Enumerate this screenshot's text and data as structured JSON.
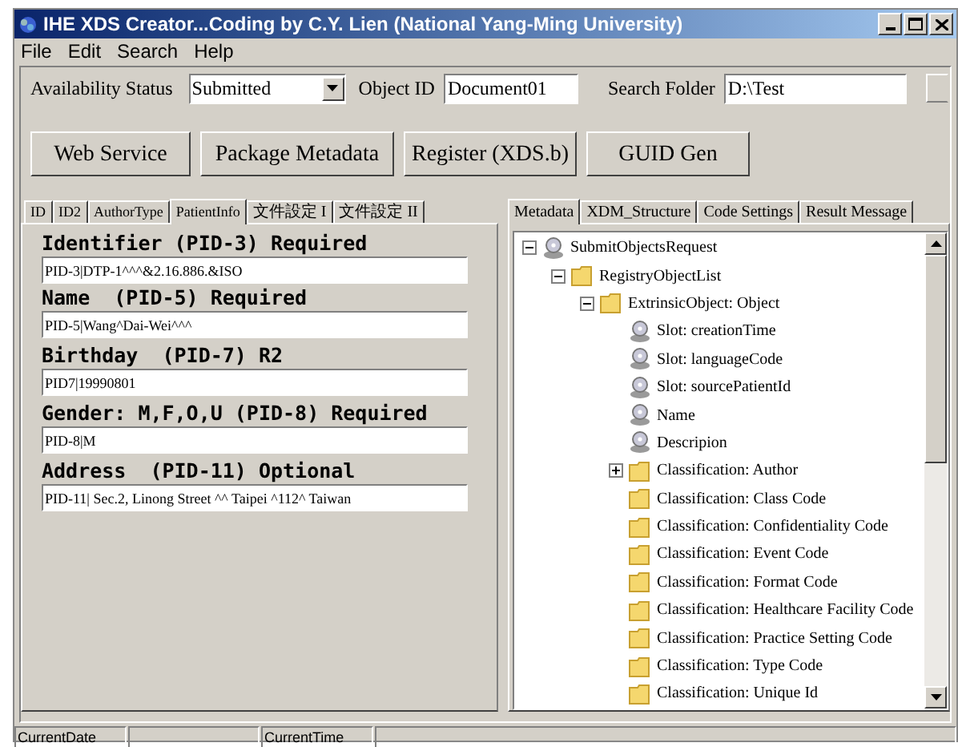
{
  "window": {
    "title": "IHE XDS Creator...Coding by C.Y. Lien (National Yang-Ming University)"
  },
  "menu": [
    "File",
    "Edit",
    "Search",
    "Help"
  ],
  "toolbar": {
    "availability_label": "Availability Status",
    "availability_value": "Submitted",
    "object_id_label": "Object ID",
    "object_id_value": "Document01",
    "search_folder_label": "Search Folder",
    "search_folder_value": "D:\\Test"
  },
  "buttons": [
    "Web Service",
    "Package Metadata",
    "Register (XDS.b)",
    "GUID Gen"
  ],
  "left_tabs": [
    {
      "label": "ID",
      "selected": false
    },
    {
      "label": "ID2",
      "selected": false
    },
    {
      "label": "AuthorType",
      "selected": false
    },
    {
      "label": "PatientInfo",
      "selected": true
    },
    {
      "label": "文件設定 I",
      "selected": false
    },
    {
      "label": "文件設定 II",
      "selected": false
    }
  ],
  "fields": [
    {
      "label": "Identifier (PID-3) Required",
      "value": "PID-3|DTP-1^^^&2.16.886.&ISO"
    },
    {
      "label": "Name  (PID-5) Required",
      "value": "PID-5|Wang^Dai-Wei^^^"
    },
    {
      "label": "Birthday  (PID-7) R2",
      "value": "PID7|19990801"
    },
    {
      "label": "Gender: M,F,O,U (PID-8) Required",
      "value": "PID-8|M"
    },
    {
      "label": "Address  (PID-11) Optional",
      "value": "PID-11| Sec.2, Linong Street ^^ Taipei ^112^ Taiwan"
    }
  ],
  "right_tabs": [
    {
      "label": "Metadata",
      "selected": true
    },
    {
      "label": "XDM_Structure",
      "selected": false
    },
    {
      "label": "Code Settings",
      "selected": false
    },
    {
      "label": "Result Message",
      "selected": false
    }
  ],
  "tree": [
    {
      "label": "SubmitObjectsRequest",
      "kind": "slot",
      "expanded": true,
      "children": [
        {
          "label": "RegistryObjectList",
          "kind": "folder",
          "expanded": true,
          "children": [
            {
              "label": "ExtrinsicObject: Object",
              "kind": "folder",
              "expanded": true,
              "children": [
                {
                  "label": "Slot: creationTime",
                  "kind": "slot"
                },
                {
                  "label": "Slot: languageCode",
                  "kind": "slot"
                },
                {
                  "label": "Slot: sourcePatientId",
                  "kind": "slot"
                },
                {
                  "label": "Name",
                  "kind": "slot"
                },
                {
                  "label": "Descripion",
                  "kind": "slot"
                },
                {
                  "label": "Classification: Author",
                  "kind": "folder",
                  "expanded": false
                },
                {
                  "label": "Classification: Class Code",
                  "kind": "folder"
                },
                {
                  "label": "Classification: Confidentiality Code",
                  "kind": "folder"
                },
                {
                  "label": "Classification: Event Code",
                  "kind": "folder"
                },
                {
                  "label": "Classification: Format Code",
                  "kind": "folder"
                },
                {
                  "label": "Classification: Healthcare Facility Code",
                  "kind": "folder"
                },
                {
                  "label": "Classification: Practice Setting Code",
                  "kind": "folder"
                },
                {
                  "label": "Classification: Type Code",
                  "kind": "folder"
                },
                {
                  "label": "Classification: Unique Id",
                  "kind": "folder"
                }
              ]
            }
          ]
        }
      ]
    }
  ],
  "status_bar": [
    "CurrentDate",
    "CurrentTime"
  ]
}
